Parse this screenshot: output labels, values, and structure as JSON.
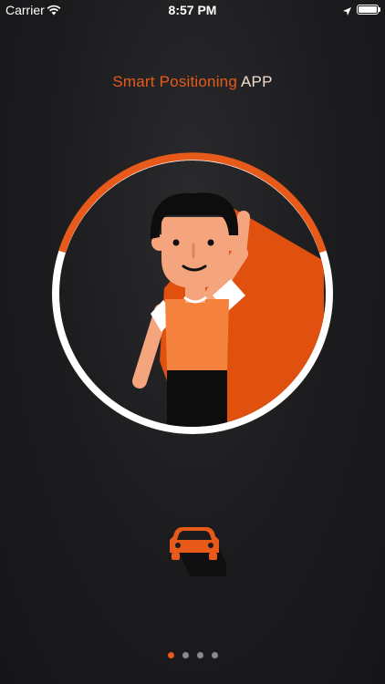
{
  "status_bar": {
    "carrier": "Carrier",
    "time": "8:57 PM",
    "icons": [
      "wifi-icon",
      "location-arrow-icon",
      "battery-icon"
    ]
  },
  "onboarding": {
    "title_part1": "Smart Positioning",
    "title_part2": "APP",
    "illustration": "person-waving-illustration",
    "feature_icon": "car-icon"
  },
  "pagination": {
    "count": 4,
    "active_index": 0
  },
  "colors": {
    "accent": "#e85a1a",
    "background": "#1b1b1d",
    "ring": "#ffffff"
  }
}
